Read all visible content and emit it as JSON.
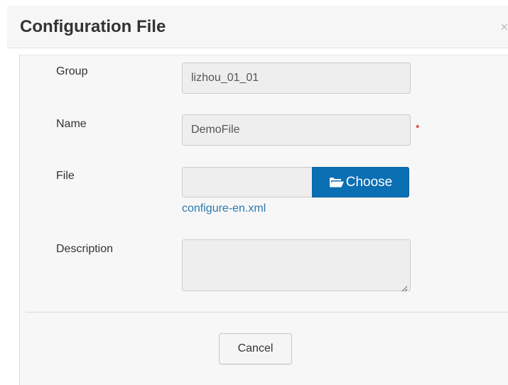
{
  "dialog": {
    "title": "Configuration File",
    "close_glyph": "×"
  },
  "form": {
    "group": {
      "label": "Group",
      "value": "lizhou_01_01"
    },
    "name": {
      "label": "Name",
      "value": "DemoFile",
      "required_mark": "*"
    },
    "file": {
      "label": "File",
      "choose_label": "Choose",
      "icon": "folder-open-icon",
      "linked_file": "configure-en.xml"
    },
    "description": {
      "label": "Description",
      "value": ""
    }
  },
  "footer": {
    "cancel_label": "Cancel"
  },
  "colors": {
    "primary_button": "#0a6fb3",
    "link": "#2a7ab0",
    "required": "#cc0000"
  }
}
